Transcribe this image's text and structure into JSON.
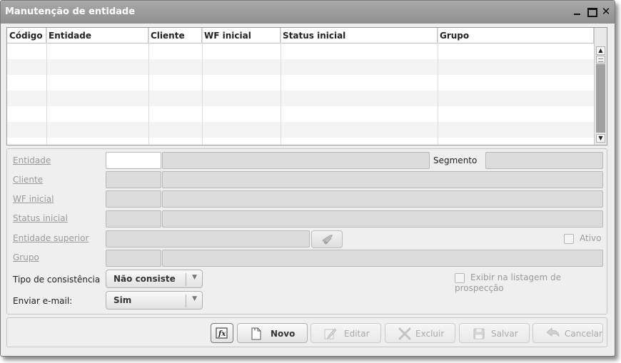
{
  "window": {
    "title": "Manutenção de entidade",
    "close_glyph": "✕"
  },
  "grid": {
    "columns": [
      "Código",
      "Entidade",
      "Cliente",
      "WF inicial",
      "Status inicial",
      "Grupo"
    ],
    "rows": []
  },
  "form": {
    "entidade_label": "Entidade",
    "segmento_label": "Segmento",
    "cliente_label": "Cliente",
    "wf_inicial_label": "WF inicial",
    "status_inicial_label": "Status inicial",
    "entidade_superior_label": "Entidade superior",
    "ativo_label": "Ativo",
    "grupo_label": "Grupo",
    "tipo_consistencia_label": "Tipo de consistência",
    "tipo_consistencia_value": "Não consiste",
    "exibir_prospeccao_label": "Exibir na listagem de prospecção",
    "enviar_email_label": "Enviar e-mail:",
    "enviar_email_value": "Sim"
  },
  "buttons": {
    "novo": "Novo",
    "editar": "Editar",
    "excluir": "Excluir",
    "salvar": "Salvar",
    "cancelar": "Cancelar"
  },
  "icons": {
    "formula": "formula-icon",
    "new_document": "new-document-icon",
    "edit": "pencil-icon",
    "delete": "x-icon",
    "save": "floppy-disk-icon",
    "cancel": "undo-arrow-icon",
    "lookup": "brush-icon"
  }
}
